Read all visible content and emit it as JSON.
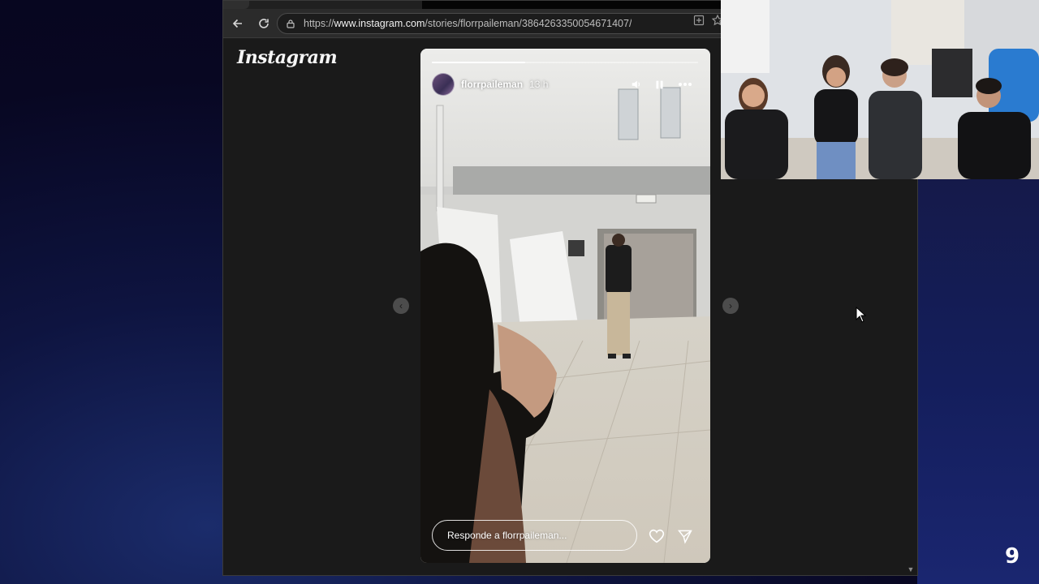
{
  "browser": {
    "url_prefix": "https://",
    "url_domain": "www.instagram.com",
    "url_path": "/stories/florrpaileman/3864263350054671407/"
  },
  "instagram": {
    "logo": "Instagram"
  },
  "story": {
    "username": "florrpaileman",
    "time_ago": "13 h",
    "progress": 0.35,
    "reply_placeholder": "Responde a florrpaileman..."
  },
  "overlay": {
    "counter": "9"
  },
  "colors": {
    "page_bg": "#1a1a1a",
    "story_wall": "#d2d2cf",
    "floor": "#dcd6c9",
    "desktop_bg": "#0e1440"
  },
  "icons": [
    "back-arrow-icon",
    "reload-icon",
    "lock-icon",
    "install-app-icon",
    "star-icon",
    "volume-icon",
    "pause-icon",
    "more-options-icon",
    "heart-icon",
    "send-icon",
    "chevron-left-icon",
    "chevron-right-icon",
    "mouse-cursor-icon"
  ]
}
